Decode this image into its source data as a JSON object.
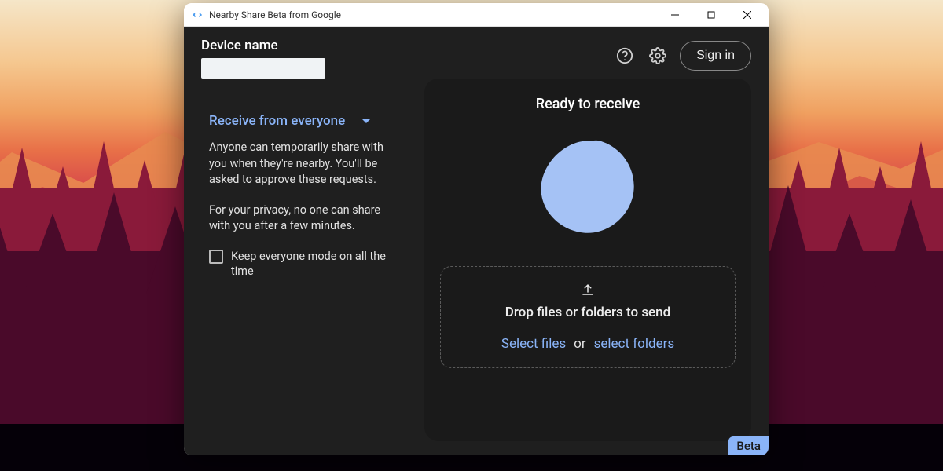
{
  "window": {
    "title": "Nearby Share Beta from Google"
  },
  "topbar": {
    "device_name_label": "Device name",
    "device_name_value": "",
    "signin_label": "Sign in"
  },
  "sidebar": {
    "dropdown_label": "Receive from everyone",
    "desc1": "Anyone can temporarily share with you when they're nearby. You'll be asked to approve these requests.",
    "desc2": "For your privacy, no one can share with you after a few minutes.",
    "checkbox_label": "Keep everyone mode on all the time",
    "checkbox_checked": false
  },
  "main": {
    "ready_label": "Ready to receive",
    "drop_label": "Drop files or folders to send",
    "select_files_label": "Select files",
    "or_label": "or",
    "select_folders_label": "select folders"
  },
  "badge": {
    "beta": "Beta"
  },
  "colors": {
    "accent": "#8ab4f8",
    "bg_app": "#1f1f1f",
    "bg_panel": "#1a1a1a"
  }
}
